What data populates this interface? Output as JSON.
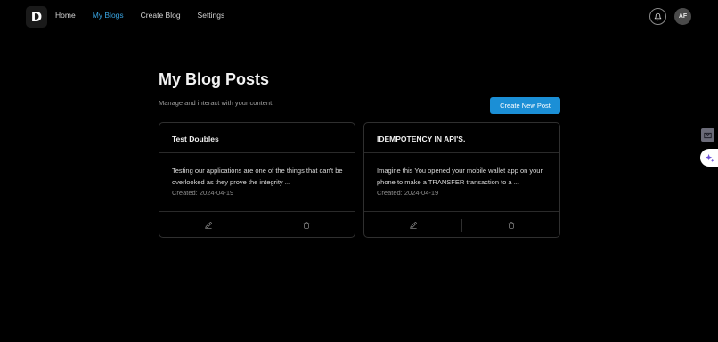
{
  "navbar": {
    "logo_letter": "D",
    "links": [
      {
        "label": "Home",
        "active": false
      },
      {
        "label": "My Blogs",
        "active": true
      },
      {
        "label": "Create Blog",
        "active": false
      },
      {
        "label": "Settings",
        "active": false
      }
    ],
    "avatar_initials": "AF",
    "accent_color": "#38a3e0"
  },
  "header": {
    "title": "My Blog Posts",
    "subtitle": "Manage and interact with your content.",
    "create_button_label": "Create New Post"
  },
  "posts": [
    {
      "title": "Test Doubles",
      "excerpt": "Testing our applications are one of the things that can't be overlooked as they prove the integrity ...",
      "created": "Created: 2024-04-19"
    },
    {
      "title": "IDEMPOTENCY IN API'S.",
      "excerpt": "Imagine this You opened your mobile wallet app on your phone to make a TRANSFER transaction to a ...",
      "created": "Created: 2024-04-19"
    }
  ],
  "icons": {
    "edit": "pencil-icon",
    "delete": "trash-icon",
    "notifications": "bell-icon"
  },
  "colors": {
    "background": "#000000",
    "primary_button": "#1b8fd6"
  }
}
